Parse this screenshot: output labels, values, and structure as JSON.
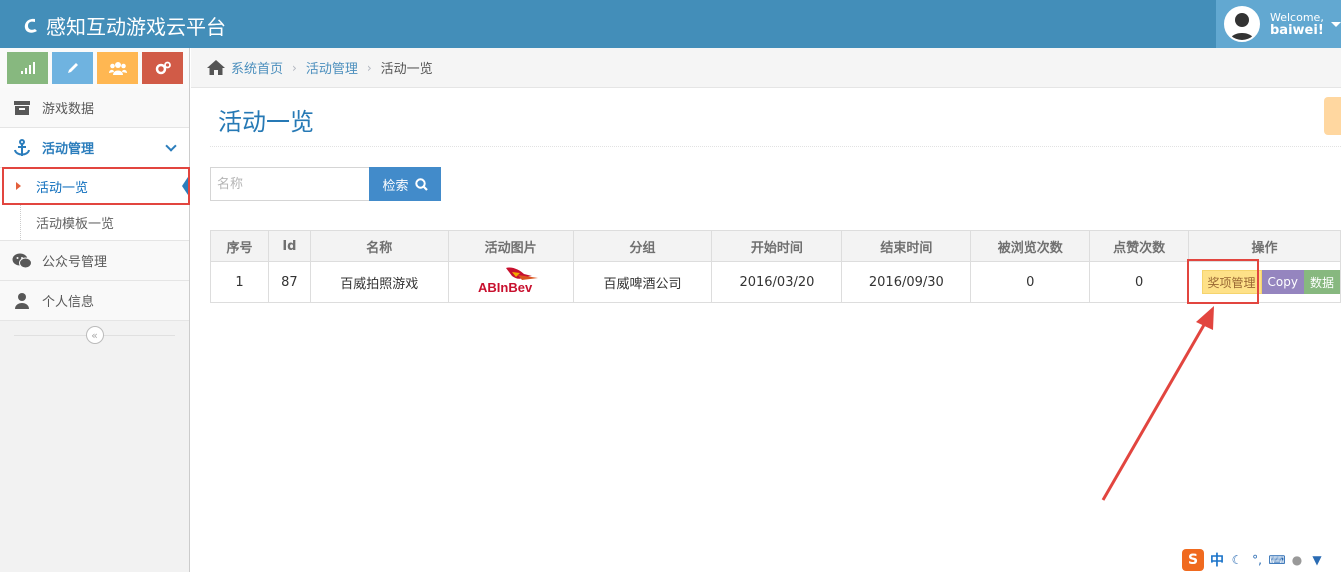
{
  "app": {
    "title": "感知互动游戏云平台"
  },
  "user": {
    "welcome": "Welcome,",
    "name": "baiwei!"
  },
  "sidebar": {
    "shortcuts": [
      {
        "icon": "signal-icon",
        "color": "#87b87f"
      },
      {
        "icon": "pencil-icon",
        "color": "#6fb3e0"
      },
      {
        "icon": "group-icon",
        "color": "#ffb752"
      },
      {
        "icon": "cogs-icon",
        "color": "#d15b47"
      }
    ],
    "items": [
      {
        "label": "游戏数据",
        "icon": "archive-icon"
      },
      {
        "label": "活动管理",
        "icon": "anchor-icon",
        "children": [
          {
            "label": "活动一览"
          },
          {
            "label": "活动模板一览"
          }
        ]
      },
      {
        "label": "公众号管理",
        "icon": "wechat-icon"
      },
      {
        "label": "个人信息",
        "icon": "user-icon"
      }
    ]
  },
  "breadcrumb": {
    "home": "系统首页",
    "section": "活动管理",
    "current": "活动一览"
  },
  "main": {
    "title": "活动一览",
    "search": {
      "placeholder": "名称",
      "value": "",
      "button": "检索"
    },
    "table": {
      "headers": [
        "序号",
        "Id",
        "名称",
        "活动图片",
        "分组",
        "开始时间",
        "结束时间",
        "被浏览次数",
        "点赞次数",
        "操作"
      ],
      "rows": [
        {
          "index": "1",
          "id": "87",
          "name": "百威拍照游戏",
          "image_text": "ABInBev",
          "group": "百威啤酒公司",
          "start": "2016/03/20",
          "end": "2016/09/30",
          "views": "0",
          "likes": "0",
          "actions": [
            "奖项管理",
            "Copy",
            "数据"
          ]
        }
      ]
    }
  },
  "tray": {
    "ime_logo": "S",
    "ime_mode": "中"
  },
  "colors": {
    "header": "#438eb9",
    "accent": "#2679b5",
    "highlight": "#e2453f"
  }
}
